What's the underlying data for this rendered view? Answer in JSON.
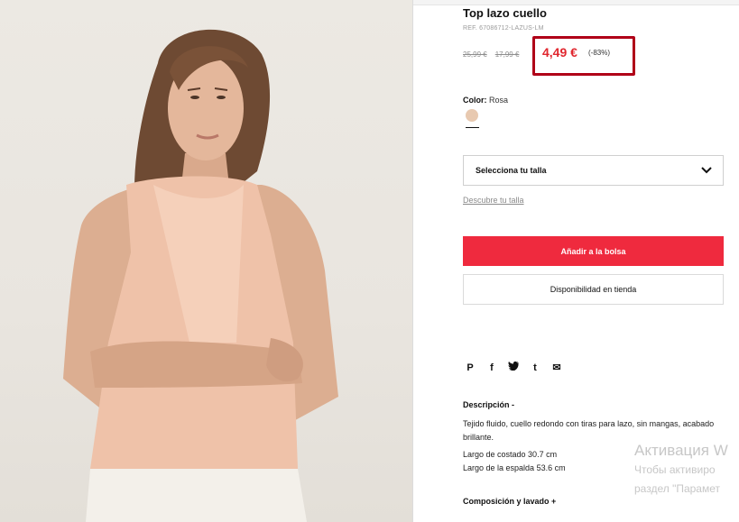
{
  "product": {
    "title": "Top lazo cuello",
    "ref": "REF. 67086712-LAZUS-LM",
    "old_price_1": "25,99 €",
    "old_price_2": "17,99 €",
    "new_price": "4,49 €",
    "discount": "(-83%)",
    "accent_color": "#e0262e",
    "highlight_color": "#b00018"
  },
  "color": {
    "label": "Color:",
    "value": "Rosa",
    "swatch_color": "#e8c9b0"
  },
  "size": {
    "select_label": "Selecciona tu talla",
    "discover_link": "Descubre tu talla"
  },
  "actions": {
    "add_to_bag": "Añadir a la bolsa",
    "add_to_bag_color": "#ef2a3e",
    "store_availability": "Disponibilidad en tienda"
  },
  "social": {
    "icons": [
      "pinterest-icon",
      "facebook-icon",
      "twitter-icon",
      "tumblr-icon",
      "email-icon"
    ],
    "glyphs": [
      "P",
      "f",
      "t",
      "t",
      "✉"
    ]
  },
  "description": {
    "title": "Descripción  -",
    "text": "Tejido fluido, cuello redondo con tiras para lazo, sin mangas, acabado brillante.",
    "measure_1": "Largo de costado 30.7 cm",
    "measure_2": "Largo de la espalda 53.6 cm",
    "composition_title": "Composición y lavado  +"
  },
  "watermark": {
    "line1": "Активация W",
    "line2": "Чтобы активиро",
    "line3": "раздел \"Парамет"
  }
}
